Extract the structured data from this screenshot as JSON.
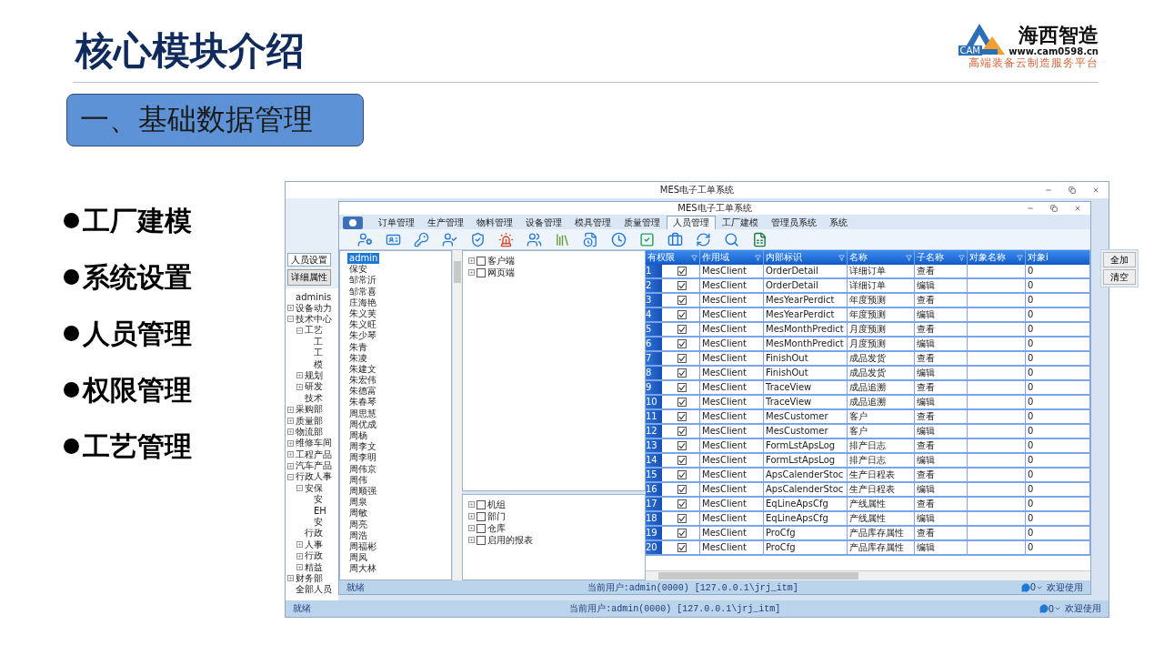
{
  "title": "核心模块介绍",
  "logo": {
    "mark": "CAM",
    "name": "海西智造",
    "url": "www.cam0598.cn",
    "tagline": "高端装备云制造服务平台"
  },
  "section": "一、基础数据管理",
  "bullets": [
    "工厂建模",
    "系统设置",
    "人员管理",
    "权限管理",
    "工艺管理"
  ],
  "back_window": {
    "title": "MES电子工单系统",
    "tabs": [
      {
        "label": "人员设置",
        "selected": true
      }
    ],
    "detail_button": "详细属性",
    "tree": [
      {
        "label": "adminis"
      },
      {
        "label": "设备动力",
        "expanded": false
      },
      {
        "label": "技术中心",
        "expanded": true,
        "children": [
          {
            "label": "工艺",
            "expanded": true,
            "children": [
              {
                "label": "工"
              },
              {
                "label": "工"
              },
              {
                "label": "模"
              }
            ]
          },
          {
            "label": "规划",
            "expanded": false
          },
          {
            "label": "研发",
            "expanded": false
          },
          {
            "label": "技术"
          }
        ]
      },
      {
        "label": "采购部",
        "expanded": false
      },
      {
        "label": "质量部",
        "expanded": false
      },
      {
        "label": "物流部",
        "expanded": false
      },
      {
        "label": "维修车间",
        "expanded": false
      },
      {
        "label": "工程产品",
        "expanded": false
      },
      {
        "label": "汽车产品",
        "expanded": false
      },
      {
        "label": "行政人事",
        "expanded": true,
        "children": [
          {
            "label": "安保",
            "expanded": true,
            "children": [
              {
                "label": "安"
              },
              {
                "label": "EH"
              },
              {
                "label": "安"
              }
            ]
          },
          {
            "label": "行政"
          },
          {
            "label": "人事",
            "expanded": false
          },
          {
            "label": "行政",
            "expanded": false
          },
          {
            "label": "精益",
            "expanded": false
          }
        ]
      },
      {
        "label": "财务部",
        "expanded": false
      },
      {
        "label": "全部人员"
      }
    ],
    "side_buttons": [
      "全加",
      "清空"
    ],
    "status": {
      "text": "就绪",
      "user": "当前用户:admin(0000) [127.0.0.1\\jrj_itm]",
      "count": "0",
      "welcome": "欢迎使用"
    }
  },
  "app_window": {
    "title": "MES电子工单系统",
    "menu": [
      {
        "label": "订单管理",
        "selected": false
      },
      {
        "label": "生产管理",
        "selected": false
      },
      {
        "label": "物料管理",
        "selected": false
      },
      {
        "label": "设备管理",
        "selected": false
      },
      {
        "label": "模具管理",
        "selected": false
      },
      {
        "label": "质量管理",
        "selected": false
      },
      {
        "label": "人员管理",
        "selected": true
      },
      {
        "label": "工厂建模",
        "selected": false
      },
      {
        "label": "管理员系统",
        "selected": false
      },
      {
        "label": "系统",
        "selected": false
      }
    ],
    "users": [
      {
        "name": "admin",
        "selected": true
      },
      {
        "name": "保安",
        "selected": false
      },
      {
        "name": "邹常沂",
        "selected": false
      },
      {
        "name": "邹常喜",
        "selected": false
      },
      {
        "name": "庄海艳",
        "selected": false
      },
      {
        "name": "朱义芙",
        "selected": false
      },
      {
        "name": "朱义旺",
        "selected": false
      },
      {
        "name": "朱少琴",
        "selected": false
      },
      {
        "name": "朱青",
        "selected": false
      },
      {
        "name": "朱凌",
        "selected": false
      },
      {
        "name": "朱建文",
        "selected": false
      },
      {
        "name": "朱宏伟",
        "selected": false
      },
      {
        "name": "朱德富",
        "selected": false
      },
      {
        "name": "朱春琴",
        "selected": false
      },
      {
        "name": "周思慧",
        "selected": false
      },
      {
        "name": "周优成",
        "selected": false
      },
      {
        "name": "周杨",
        "selected": false
      },
      {
        "name": "周李文",
        "selected": false
      },
      {
        "name": "周李明",
        "selected": false
      },
      {
        "name": "周伟京",
        "selected": false
      },
      {
        "name": "周伟",
        "selected": false
      },
      {
        "name": "周顺强",
        "selected": false
      },
      {
        "name": "周泉",
        "selected": false
      },
      {
        "name": "周敏",
        "selected": false
      },
      {
        "name": "周亮",
        "selected": false
      },
      {
        "name": "周浩",
        "selected": false
      },
      {
        "name": "周福彬",
        "selected": false
      },
      {
        "name": "周凤",
        "selected": false
      },
      {
        "name": "周大林",
        "selected": false
      }
    ],
    "perm_tree_top": [
      {
        "label": "客户端",
        "checked": false,
        "expanded": false
      },
      {
        "label": "网页端",
        "checked": false,
        "expanded": false
      }
    ],
    "perm_tree_bottom": [
      {
        "label": "机组",
        "checked": false,
        "expanded": false
      },
      {
        "label": "部门",
        "checked": false,
        "expanded": false
      },
      {
        "label": "仓库",
        "checked": false,
        "expanded": false
      },
      {
        "label": "启用的报表",
        "checked": false,
        "expanded": false
      }
    ],
    "columns": [
      "有权限",
      "作用域",
      "内部标识",
      "名称",
      "子名称",
      "对象名称",
      "对象i"
    ],
    "rows": [
      {
        "no": "1",
        "checked": true,
        "domain": "MesClient",
        "key": "OrderDetail",
        "name": "详细订单",
        "sub": "查看",
        "object_id": "0"
      },
      {
        "no": "2",
        "checked": true,
        "domain": "MesClient",
        "key": "OrderDetail",
        "name": "详细订单",
        "sub": "编辑",
        "object_id": "0"
      },
      {
        "no": "3",
        "checked": true,
        "domain": "MesClient",
        "key": "MesYearPerdict",
        "name": "年度预测",
        "sub": "查看",
        "object_id": "0"
      },
      {
        "no": "4",
        "checked": true,
        "domain": "MesClient",
        "key": "MesYearPerdict",
        "name": "年度预测",
        "sub": "编辑",
        "object_id": "0"
      },
      {
        "no": "5",
        "checked": true,
        "domain": "MesClient",
        "key": "MesMonthPredict",
        "name": "月度预测",
        "sub": "查看",
        "object_id": "0"
      },
      {
        "no": "6",
        "checked": true,
        "domain": "MesClient",
        "key": "MesMonthPredict",
        "name": "月度预测",
        "sub": "编辑",
        "object_id": "0"
      },
      {
        "no": "7",
        "checked": true,
        "domain": "MesClient",
        "key": "FinishOut",
        "name": "成品发货",
        "sub": "查看",
        "object_id": "0"
      },
      {
        "no": "8",
        "checked": true,
        "domain": "MesClient",
        "key": "FinishOut",
        "name": "成品发货",
        "sub": "编辑",
        "object_id": "0"
      },
      {
        "no": "9",
        "checked": true,
        "domain": "MesClient",
        "key": "TraceView",
        "name": "成品追溯",
        "sub": "查看",
        "object_id": "0"
      },
      {
        "no": "10",
        "checked": true,
        "domain": "MesClient",
        "key": "TraceView",
        "name": "成品追溯",
        "sub": "编辑",
        "object_id": "0"
      },
      {
        "no": "11",
        "checked": true,
        "domain": "MesClient",
        "key": "MesCustomer",
        "name": "客户",
        "sub": "查看",
        "object_id": "0"
      },
      {
        "no": "12",
        "checked": true,
        "domain": "MesClient",
        "key": "MesCustomer",
        "name": "客户",
        "sub": "编辑",
        "object_id": "0"
      },
      {
        "no": "13",
        "checked": true,
        "domain": "MesClient",
        "key": "FormLstApsLog",
        "name": "排产日志",
        "sub": "查看",
        "object_id": "0"
      },
      {
        "no": "14",
        "checked": true,
        "domain": "MesClient",
        "key": "FormLstApsLog",
        "name": "排产日志",
        "sub": "编辑",
        "object_id": "0"
      },
      {
        "no": "15",
        "checked": true,
        "domain": "MesClient",
        "key": "ApsCalenderStoc",
        "name": "生产日程表",
        "sub": "查看",
        "object_id": "0"
      },
      {
        "no": "16",
        "checked": true,
        "domain": "MesClient",
        "key": "ApsCalenderStoc",
        "name": "生产日程表",
        "sub": "编辑",
        "object_id": "0"
      },
      {
        "no": "17",
        "checked": true,
        "domain": "MesClient",
        "key": "EqLineApsCfg",
        "name": "产线属性",
        "sub": "查看",
        "object_id": "0"
      },
      {
        "no": "18",
        "checked": true,
        "domain": "MesClient",
        "key": "EqLineApsCfg",
        "name": "产线属性",
        "sub": "编辑",
        "object_id": "0"
      },
      {
        "no": "19",
        "checked": true,
        "domain": "MesClient",
        "key": "ProCfg",
        "name": "产品库存属性",
        "sub": "查看",
        "object_id": "0"
      },
      {
        "no": "20",
        "checked": true,
        "domain": "MesClient",
        "key": "ProCfg",
        "name": "产品库存属性",
        "sub": "编辑",
        "object_id": "0"
      }
    ],
    "status": {
      "text": "就绪",
      "user": "当前用户:admin(0000) [127.0.0.1\\jrj_itm]",
      "count": "0",
      "welcome": "欢迎使用"
    }
  }
}
